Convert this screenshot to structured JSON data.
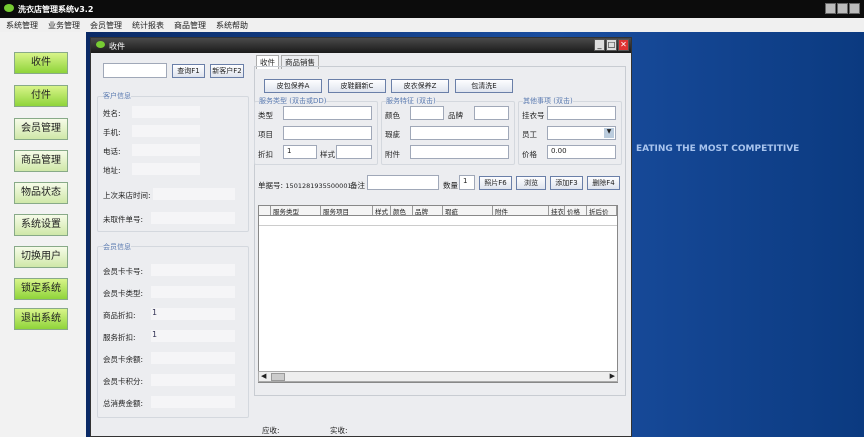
{
  "app": {
    "title": "洗衣店管理系统v3.2"
  },
  "menu": [
    "系统管理",
    "业务管理",
    "会员管理",
    "统计报表",
    "商品管理",
    "系统帮助"
  ],
  "sidebar": [
    "收件",
    "付件",
    "会员管理",
    "商品管理",
    "物品状态",
    "系统设置",
    "切换用户",
    "锁定系统",
    "退出系统"
  ],
  "banner_text": "EATING THE MOST COMPETITIVE",
  "window": {
    "title": "收件"
  },
  "search": {
    "value": "",
    "query_btn": "查询F1",
    "new_customer_btn": "新客户F2"
  },
  "customer": {
    "title": "客户信息",
    "fields": [
      "姓名:",
      "手机:",
      "电话:",
      "地址:",
      "上次来店时间:",
      "未取件单号:"
    ]
  },
  "member": {
    "title": "会员信息",
    "fields": [
      {
        "label": "会员卡卡号:",
        "value": ""
      },
      {
        "label": "会员卡类型:",
        "value": ""
      },
      {
        "label": "商品折扣:",
        "value": "1"
      },
      {
        "label": "服务折扣:",
        "value": "1"
      },
      {
        "label": "会员卡余额:",
        "value": ""
      },
      {
        "label": "会员卡积分:",
        "value": ""
      },
      {
        "label": "总消费金额:",
        "value": ""
      }
    ]
  },
  "tabs": [
    "收件",
    "商品销售"
  ],
  "quick_buttons": [
    "皮包保养A",
    "皮鞋翻新C",
    "皮衣保养Z",
    "包清洗E"
  ],
  "service_type": {
    "title": "服务类型 (双击或DD)",
    "type": "类型",
    "item": "项目",
    "discount": "折扣",
    "discount_value": "1",
    "style": "样式"
  },
  "service_feature": {
    "title": "服务特征 (双击)",
    "color": "颜色",
    "brand": "品牌",
    "defect": "瑕疵",
    "attachment": "附件"
  },
  "other": {
    "title": "其他事项 (双击)",
    "hanger": "挂衣号",
    "staff": "员工",
    "price": "价格",
    "price_value": "0.00"
  },
  "order": {
    "label": "单据号:",
    "number": "1501281935500001",
    "note": "备注",
    "qty_label": "数量",
    "qty": "1",
    "photo": "照片F6",
    "browse": "浏览",
    "add": "添加F3",
    "delete": "删除F4"
  },
  "columns": [
    "服务类型",
    "服务项目",
    "样式",
    "颜色",
    "品牌",
    "瑕疵",
    "附件",
    "挂衣号",
    "价格",
    "折后价"
  ],
  "footer": {
    "receivable": "应收:",
    "received": "实收:"
  }
}
